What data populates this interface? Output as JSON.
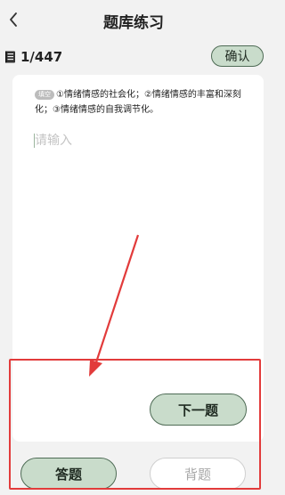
{
  "nav": {
    "title": "题库练习",
    "back_icon": "chevron-left-icon"
  },
  "progress": {
    "count": "1/447",
    "icon": "book-icon",
    "confirm_label": "确认"
  },
  "question": {
    "tag": "填空",
    "text": "①情绪情感的社会化；②情绪情感的丰富和深刻化；③情绪情感的自我调节化。"
  },
  "answer_input": {
    "placeholder": "请输入",
    "value": ""
  },
  "next_label": "下一题",
  "bottom": {
    "answer_label": "答题",
    "recite_label": "背题"
  },
  "colors": {
    "accent_fill": "#c9dccb",
    "accent_border": "#4e6b55",
    "annotation_red": "#e23b3b",
    "background": "#f2f2f2"
  }
}
